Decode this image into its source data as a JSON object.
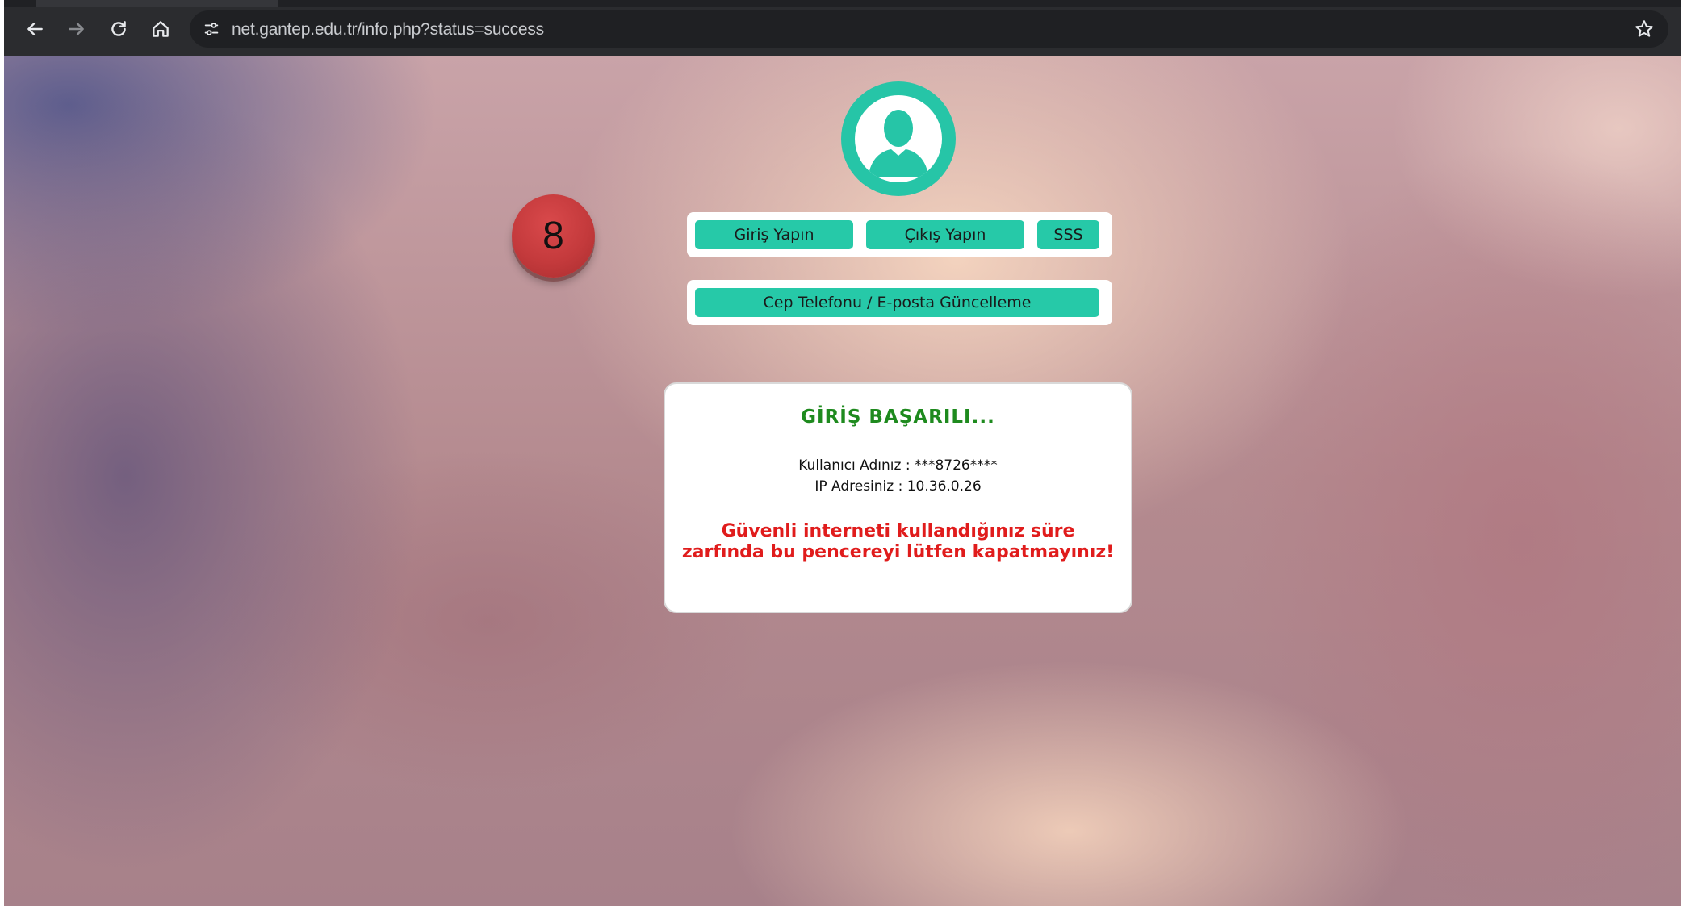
{
  "browser": {
    "url": "net.gantep.edu.tr/info.php?status=success",
    "icons": {
      "back": "arrow-left-icon",
      "forward": "arrow-right-icon",
      "reload": "reload-icon",
      "home": "home-icon",
      "site_info": "tune-icon",
      "bookmark": "star-icon"
    }
  },
  "page": {
    "avatar_icon": "user-avatar-icon",
    "step_badge": "8",
    "menu": {
      "login_label": "Giriş Yapın",
      "logout_label": "Çıkış Yapın",
      "faq_label": "SSS",
      "update_label": "Cep Telefonu / E-posta Güncelleme"
    },
    "status": {
      "title": "GİRİŞ BAŞARILI...",
      "username_line": "Kullanıcı Adınız : ***8726****",
      "ip_line": "IP Adresiniz : 10.36.0.26",
      "warning_line1": "Güvenli interneti kullandığınız süre",
      "warning_line2": "zarfında bu pencereyi lütfen kapatmayınız!"
    }
  },
  "colors": {
    "accent": "#26c9a8",
    "success": "#1e8a1e",
    "warning": "#e01c1c",
    "badge": "#c43a3c"
  }
}
